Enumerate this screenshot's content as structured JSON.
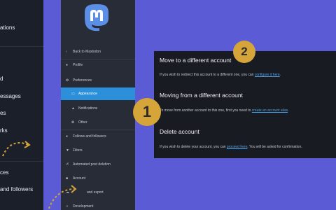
{
  "left_panel": {
    "items": [
      "ations",
      "d",
      "essages",
      "es",
      "rks",
      "ces",
      "and followers"
    ]
  },
  "sidebar": {
    "items": [
      {
        "label": "Back to Mastodon",
        "icon": "chevron-left-icon"
      },
      {
        "label": "Profile",
        "icon": "user-icon"
      },
      {
        "label": "Preferences",
        "icon": "gear-icon"
      },
      {
        "label": "Appearance",
        "icon": "monitor-icon"
      },
      {
        "label": "Notifications",
        "icon": "bell-icon"
      },
      {
        "label": "Other",
        "icon": "gear-icon"
      },
      {
        "label": "Follows and followers",
        "icon": "users-icon"
      },
      {
        "label": "Filters",
        "icon": "filter-icon"
      },
      {
        "label": "Automated post deletion",
        "icon": "history-icon"
      },
      {
        "label": "Account",
        "icon": "lock-icon"
      },
      {
        "label": "and export",
        "icon": "cloud-icon"
      },
      {
        "label": "Development",
        "icon": "code-icon"
      }
    ]
  },
  "main": {
    "move": {
      "title": "Move to a different account",
      "text": "If you wish to redirect this account to a different one, you can ",
      "link": "configure it here",
      "text_end": "."
    },
    "moving_from": {
      "title": "Moving from a different account",
      "text": "To move from another account to this one, first you need to ",
      "link": "create an account alias",
      "text_end": "."
    },
    "delete": {
      "title": "Delete account",
      "text": "If you wish to delete your account, you can ",
      "link": "proceed here",
      "text_end": ". You will be asked for confirmation."
    }
  },
  "badges": {
    "one": "1",
    "two": "2"
  },
  "colors": {
    "accent": "#2b90d9",
    "badge": "#d6a53a",
    "background": "#5b5bd6"
  }
}
